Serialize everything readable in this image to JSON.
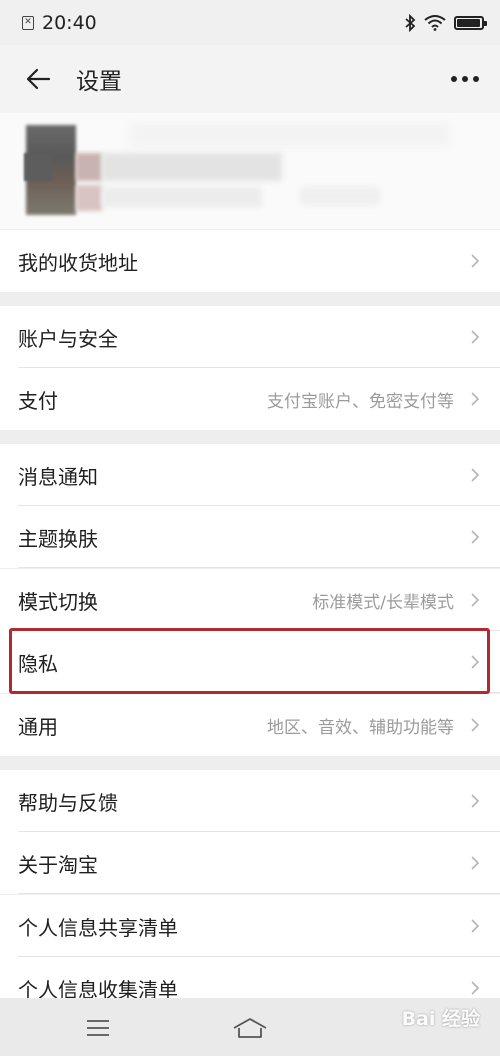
{
  "status_bar": {
    "time": "20:40",
    "battery_level": 0.9
  },
  "header": {
    "title": "设置",
    "back_icon": "arrow-left-icon",
    "more_icon": "more-horizontal-icon"
  },
  "rows": [
    {
      "label": "我的收货地址",
      "value": ""
    },
    {
      "label": "账户与安全",
      "value": ""
    },
    {
      "label": "支付",
      "value": "支付宝账户、免密支付等"
    },
    {
      "label": "消息通知",
      "value": ""
    },
    {
      "label": "主题换肤",
      "value": ""
    },
    {
      "label": "模式切换",
      "value": "标准模式/长辈模式"
    },
    {
      "label": "隐私",
      "value": ""
    },
    {
      "label": "通用",
      "value": "地区、音效、辅助功能等"
    },
    {
      "label": "帮助与反馈",
      "value": ""
    },
    {
      "label": "关于淘宝",
      "value": ""
    },
    {
      "label": "个人信息共享清单",
      "value": ""
    },
    {
      "label": "个人信息收集清单",
      "value": ""
    }
  ],
  "highlighted_row": "隐私",
  "watermark": "Bai 经验",
  "colors": {
    "highlight": "#b02a2f",
    "background": "#eeeeee",
    "row": "#ffffff",
    "secondary_text": "#9b9b9b"
  }
}
